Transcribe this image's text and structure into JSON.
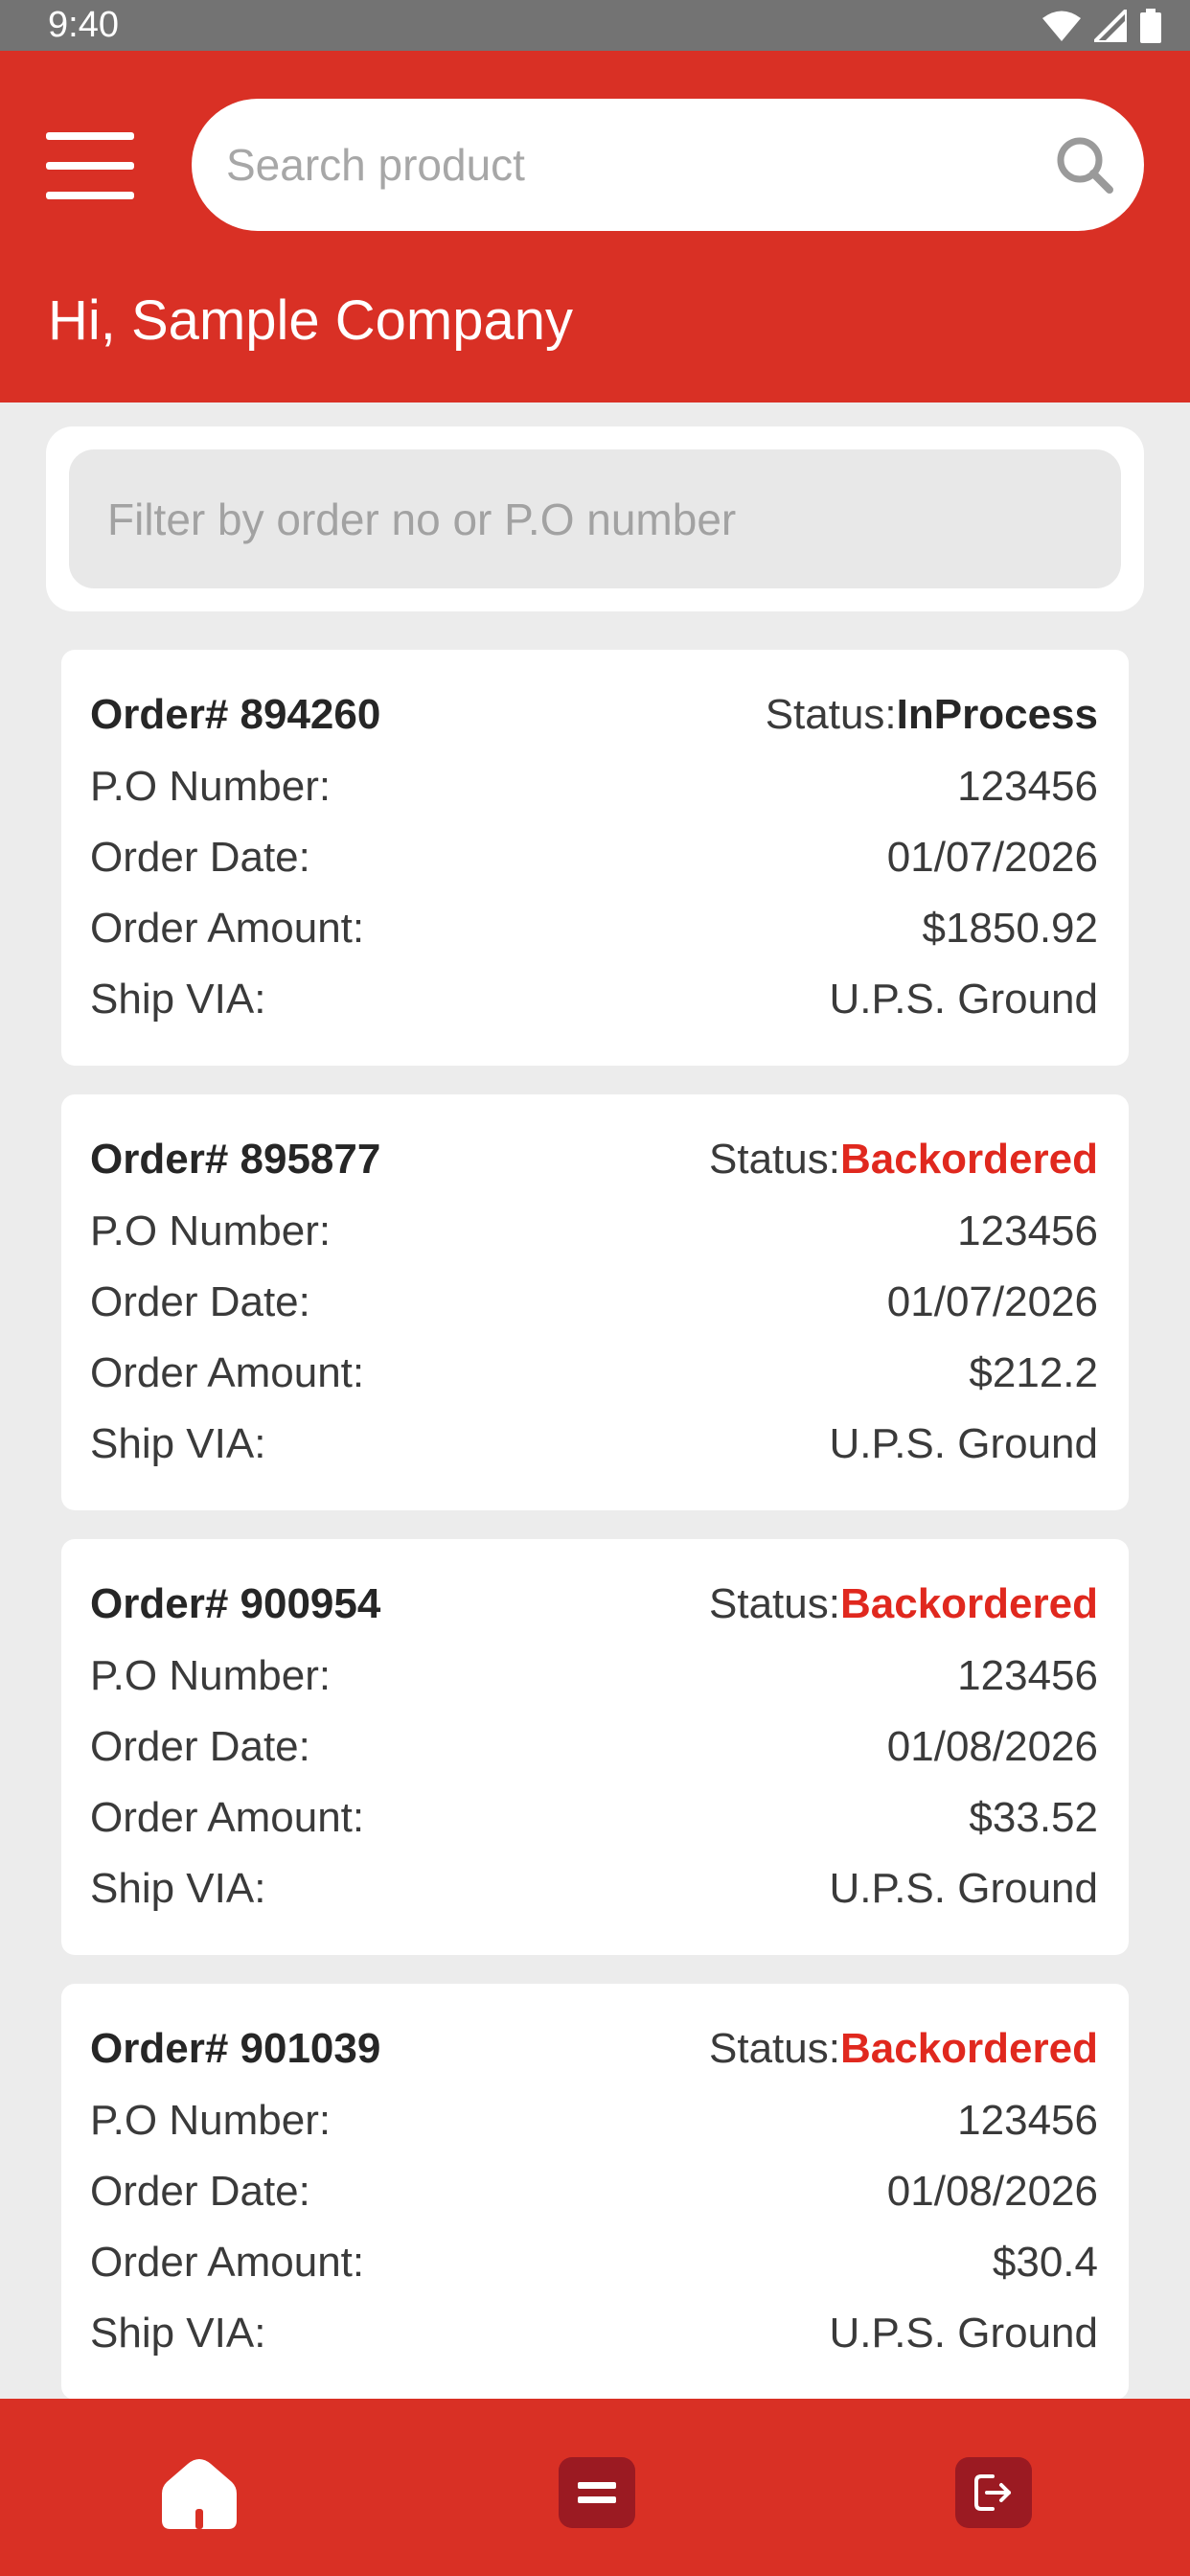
{
  "status_bar": {
    "time": "9:40"
  },
  "header": {
    "search_placeholder": "Search product",
    "greeting": "Hi, Sample Company"
  },
  "filter": {
    "placeholder": "Filter by order no or P.O number"
  },
  "colors": {
    "brand_red": "#d93025",
    "status_inprocess": "#262626",
    "status_backordered": "#e0281e"
  },
  "labels": {
    "status": "Status:",
    "po_number": "P.O Number:",
    "order_date": "Order Date:",
    "order_amount": "Order Amount:",
    "ship_via": "Ship VIA:"
  },
  "orders": [
    {
      "order_no": "Order# 894260",
      "status": "InProcess",
      "po_number": "123456",
      "order_date": "01/07/2026",
      "order_amount": "$1850.92",
      "ship_via": "U.P.S. Ground"
    },
    {
      "order_no": "Order# 895877",
      "status": "Backordered",
      "po_number": "123456",
      "order_date": "01/07/2026",
      "order_amount": "$212.2",
      "ship_via": "U.P.S. Ground"
    },
    {
      "order_no": "Order# 900954",
      "status": "Backordered",
      "po_number": "123456",
      "order_date": "01/08/2026",
      "order_amount": "$33.52",
      "ship_via": "U.P.S. Ground"
    },
    {
      "order_no": "Order# 901039",
      "status": "Backordered",
      "po_number": "123456",
      "order_date": "01/08/2026",
      "order_amount": "$30.4",
      "ship_via": "U.P.S. Ground"
    }
  ],
  "bottom_nav": {
    "items": [
      {
        "icon": "home-icon"
      },
      {
        "icon": "orders-list-icon"
      },
      {
        "icon": "logout-icon"
      }
    ]
  }
}
